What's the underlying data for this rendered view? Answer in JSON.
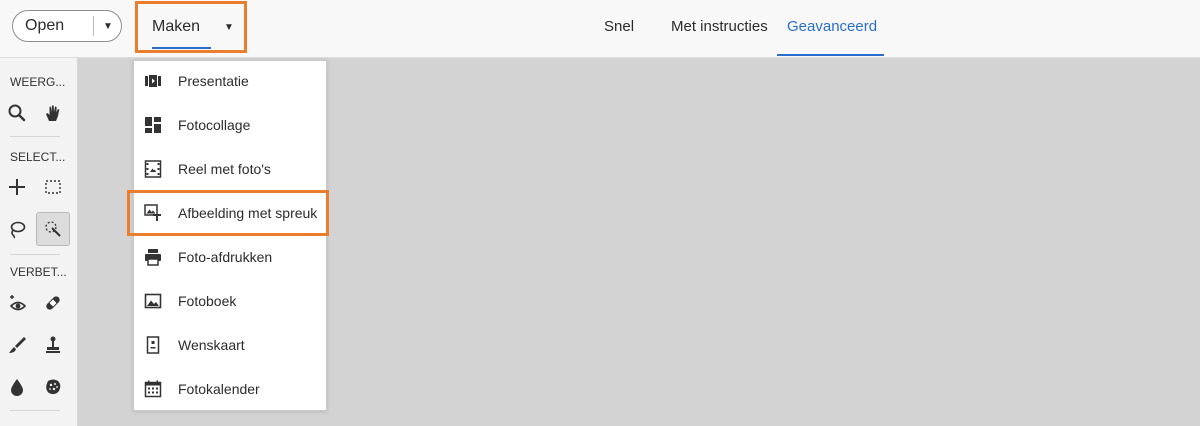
{
  "topbar": {
    "open_label": "Open",
    "maken_label": "Maken",
    "tabs": [
      {
        "label": "Snel",
        "active": false
      },
      {
        "label": "Met instructies",
        "active": false
      },
      {
        "label": "Geavanceerd",
        "active": true
      }
    ]
  },
  "toolbar": {
    "sections": [
      {
        "heading": "WEERG...",
        "tools": [
          "zoom-icon",
          "hand-icon"
        ]
      },
      {
        "heading": "SELECT...",
        "tools": [
          "move-icon",
          "marquee-icon",
          "lasso-icon",
          "quick-selection-icon"
        ]
      },
      {
        "heading": "VERBET...",
        "tools": [
          "red-eye-icon",
          "spot-healing-icon",
          "brush-icon",
          "clone-stamp-icon",
          "blur-icon",
          "sponge-icon"
        ]
      }
    ],
    "selected_tool": "quick-selection-icon"
  },
  "create_menu": {
    "items": [
      {
        "label": "Presentatie",
        "icon": "slideshow-icon"
      },
      {
        "label": "Fotocollage",
        "icon": "collage-icon"
      },
      {
        "label": "Reel met foto's",
        "icon": "film-reel-icon"
      },
      {
        "label": "Afbeelding met spreuk",
        "icon": "quote-graphic-icon",
        "highlighted": true
      },
      {
        "label": "Foto-afdrukken",
        "icon": "printer-icon"
      },
      {
        "label": "Fotoboek",
        "icon": "photo-book-icon"
      },
      {
        "label": "Wenskaart",
        "icon": "greeting-card-icon"
      },
      {
        "label": "Fotokalender",
        "icon": "calendar-icon"
      }
    ]
  },
  "colors": {
    "accent": "#2a6ecb",
    "highlight": "#e87e2e",
    "canvas": "#d3d3d3"
  }
}
